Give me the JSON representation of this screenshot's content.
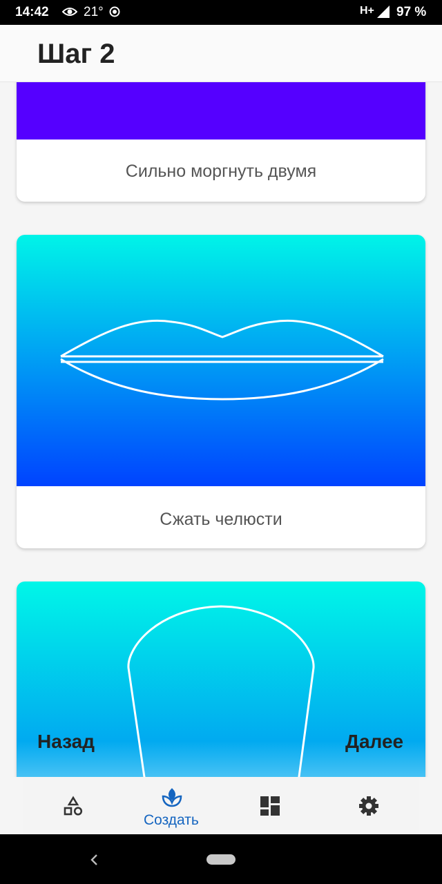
{
  "status_bar": {
    "time": "14:42",
    "temperature": "21°",
    "network": "H+",
    "battery": "97 %"
  },
  "app_bar": {
    "title": "Шаг 2"
  },
  "cards": [
    {
      "label": "Сильно моргнуть двумя",
      "color": "#5500ff"
    },
    {
      "label": "Сжать челюсти",
      "image": "lips-outline"
    },
    {
      "label": "",
      "image": "head-outline"
    }
  ],
  "actions": {
    "back": "Назад",
    "next": "Далее"
  },
  "bottom_nav": [
    {
      "icon": "shapes-icon",
      "label": ""
    },
    {
      "icon": "sprout-icon",
      "label": "Создать",
      "active": true
    },
    {
      "icon": "dashboard-icon",
      "label": ""
    },
    {
      "icon": "settings-icon",
      "label": ""
    }
  ],
  "accent_color": "#1565c0"
}
